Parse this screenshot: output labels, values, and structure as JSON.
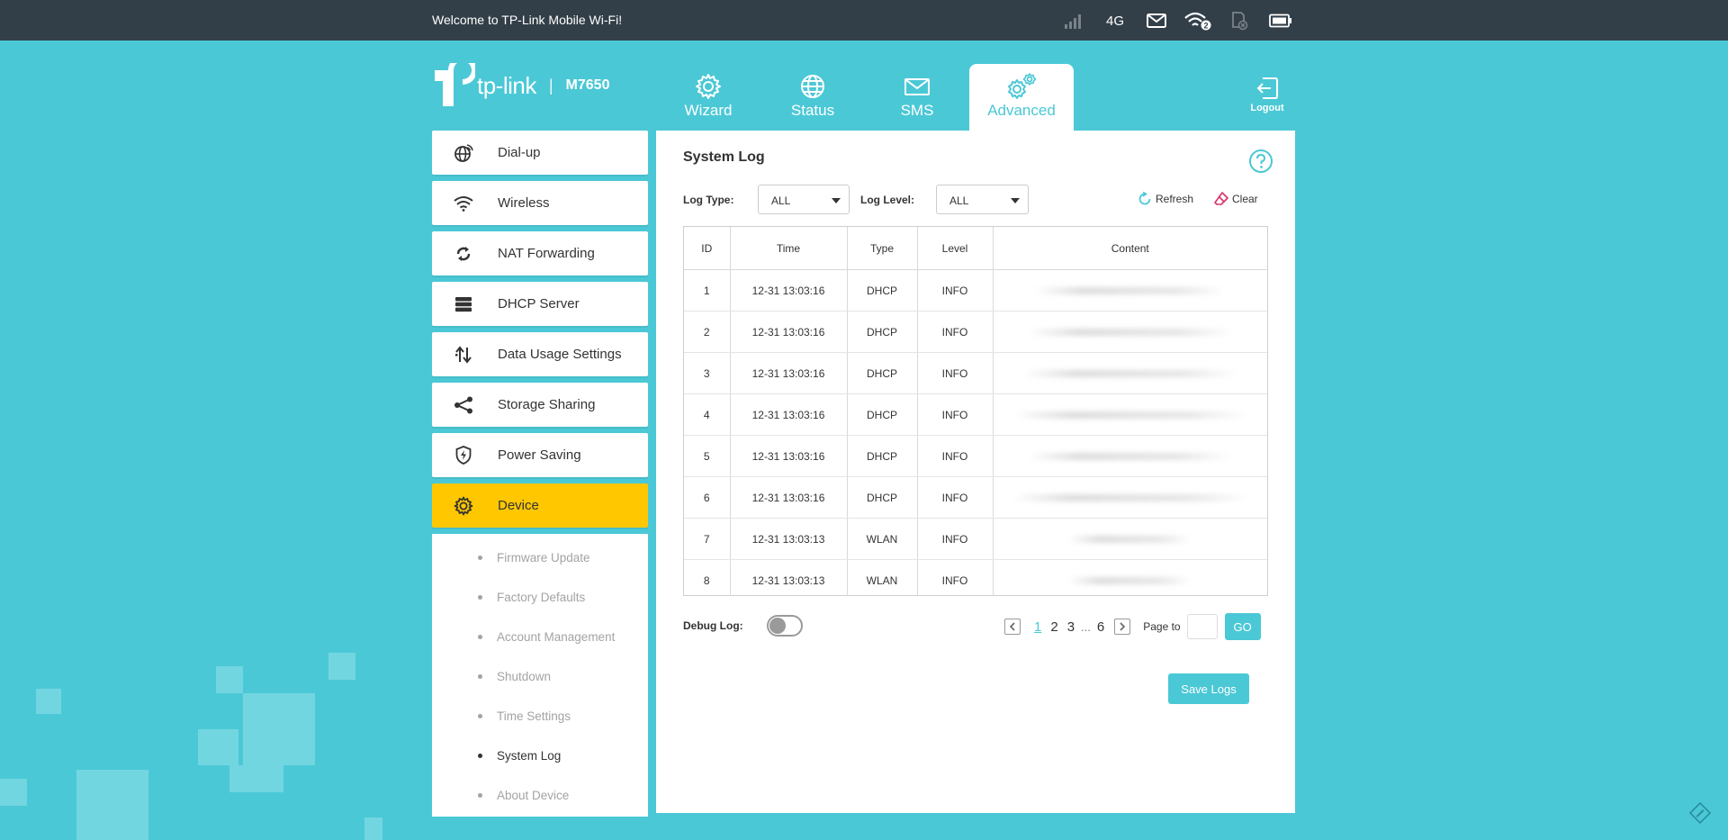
{
  "topbar": {
    "welcome": "Welcome to TP-Link Mobile Wi-Fi!",
    "network_type": "4G",
    "wifi_clients": "2"
  },
  "brand": {
    "logo_text": "tp-link",
    "separator": "|",
    "model": "M7650"
  },
  "nav": {
    "tabs": [
      {
        "label": "Wizard"
      },
      {
        "label": "Status"
      },
      {
        "label": "SMS"
      },
      {
        "label": "Advanced"
      }
    ],
    "active_tab": "Advanced",
    "logout_label": "Logout"
  },
  "sidebar": {
    "items": [
      {
        "label": "Dial-up"
      },
      {
        "label": "Wireless"
      },
      {
        "label": "NAT Forwarding"
      },
      {
        "label": "DHCP Server"
      },
      {
        "label": "Data Usage Settings"
      },
      {
        "label": "Storage Sharing"
      },
      {
        "label": "Power Saving"
      },
      {
        "label": "Device"
      }
    ],
    "active_item": "Device",
    "submenu": [
      {
        "label": "Firmware Update"
      },
      {
        "label": "Factory Defaults"
      },
      {
        "label": "Account Management"
      },
      {
        "label": "Shutdown"
      },
      {
        "label": "Time Settings"
      },
      {
        "label": "System Log"
      },
      {
        "label": "About Device"
      }
    ],
    "active_subitem": "System Log"
  },
  "main": {
    "title": "System Log",
    "filters": {
      "log_type_label": "Log Type:",
      "log_type_value": "ALL",
      "log_level_label": "Log Level:",
      "log_level_value": "ALL"
    },
    "actions": {
      "refresh_label": "Refresh",
      "clear_label": "Clear"
    },
    "table": {
      "headers": [
        "ID",
        "Time",
        "Type",
        "Level",
        "Content"
      ],
      "rows": [
        {
          "id": "1",
          "time": "12-31 13:03:16",
          "type": "DHCP",
          "level": "INFO"
        },
        {
          "id": "2",
          "time": "12-31 13:03:16",
          "type": "DHCP",
          "level": "INFO"
        },
        {
          "id": "3",
          "time": "12-31 13:03:16",
          "type": "DHCP",
          "level": "INFO"
        },
        {
          "id": "4",
          "time": "12-31 13:03:16",
          "type": "DHCP",
          "level": "INFO"
        },
        {
          "id": "5",
          "time": "12-31 13:03:16",
          "type": "DHCP",
          "level": "INFO"
        },
        {
          "id": "6",
          "time": "12-31 13:03:16",
          "type": "DHCP",
          "level": "INFO"
        },
        {
          "id": "7",
          "time": "12-31 13:03:13",
          "type": "WLAN",
          "level": "INFO"
        },
        {
          "id": "8",
          "time": "12-31 13:03:13",
          "type": "WLAN",
          "level": "INFO"
        }
      ]
    },
    "debug_log_label": "Debug Log:",
    "debug_log_enabled": false,
    "pagination": {
      "pages": [
        "1",
        "2",
        "3"
      ],
      "ellipsis": "...",
      "last_page": "6",
      "current": "1",
      "page_to_label": "Page to",
      "page_to_value": "",
      "go_label": "GO"
    },
    "save_logs_label": "Save Logs"
  },
  "colors": {
    "accent": "#4bc8d6",
    "topbar": "#333f48",
    "active_menu": "#ffc700"
  }
}
